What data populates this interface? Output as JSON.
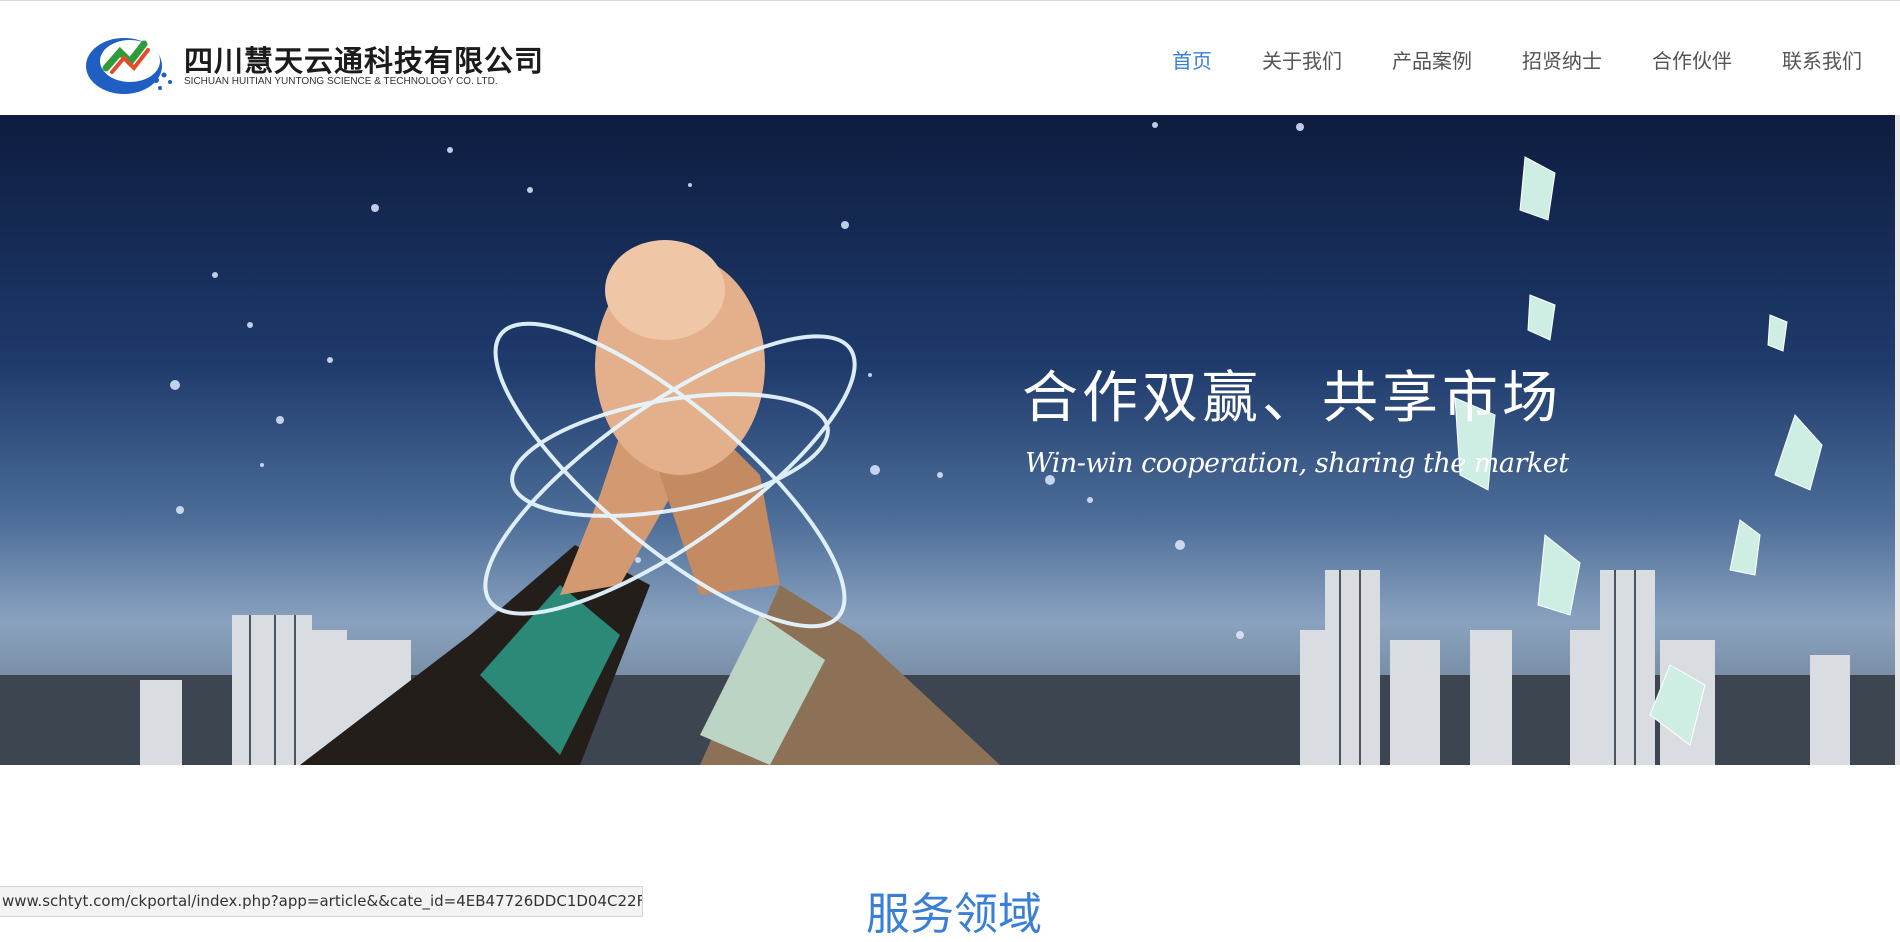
{
  "header": {
    "logo": {
      "name_cn": "四川慧天云通科技有限公司",
      "name_en": "SICHUAN HUITIAN YUNTONG SCIENCE & TECHNOLOGY CO. LTD."
    },
    "nav": [
      {
        "label": "首页",
        "active": true
      },
      {
        "label": "关于我们",
        "active": false
      },
      {
        "label": "产品案例",
        "active": false
      },
      {
        "label": "招贤纳士",
        "active": false
      },
      {
        "label": "合作伙伴",
        "active": false
      },
      {
        "label": "联系我们",
        "active": false
      }
    ]
  },
  "banner": {
    "title": "合作双赢、共享市场",
    "subtitle": "Win-win cooperation, sharing the market",
    "dot_count": 5
  },
  "section": {
    "title": "服务领域"
  },
  "status_bar": {
    "url": "www.schtyt.com/ckportal/index.php?app=article&&cate_id=4EB47726DDC1D04C22F..."
  },
  "colors": {
    "accent": "#3a7fd6",
    "nav_text": "#555555",
    "banner_top": "#0d1c3f"
  }
}
